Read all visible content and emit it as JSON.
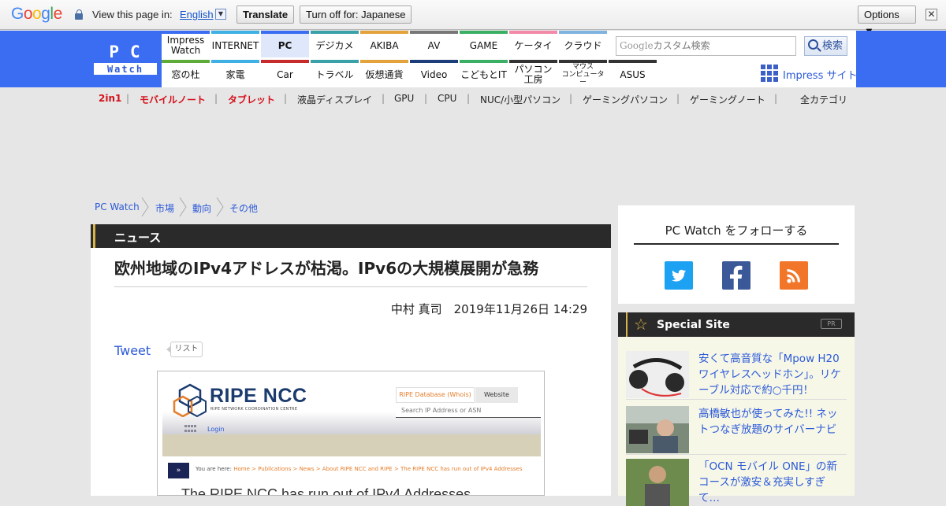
{
  "translate_bar": {
    "logo": "Google",
    "view_label": "View this page in:",
    "language": "English",
    "dropdown_glyph": "▼",
    "translate_button": "Translate",
    "turn_off_button": "Turn off for: Japanese",
    "options_button": "Options ▼",
    "close_glyph": "✕"
  },
  "site": {
    "logo_top": "PC",
    "logo_bottom": "Watch",
    "nav_top": [
      {
        "label": "Impress\nWatch",
        "color": "#3b6df2"
      },
      {
        "label": "INTERNET",
        "color": "#3fb0e4"
      },
      {
        "label": "PC",
        "color": "#3b6df2"
      },
      {
        "label": "デジカメ",
        "color": "#3aa1a8"
      },
      {
        "label": "AKIBA",
        "color": "#e3a23b"
      },
      {
        "label": "AV",
        "color": "#777777"
      },
      {
        "label": "GAME",
        "color": "#3bb064"
      },
      {
        "label": "ケータイ",
        "color": "#f28aa8"
      },
      {
        "label": "クラウド",
        "color": "#7fb3e0"
      }
    ],
    "nav_bottom": [
      {
        "label": "窓の杜",
        "color": "#5eab3a"
      },
      {
        "label": "家電",
        "color": "#3fb0e4"
      },
      {
        "label": "Car",
        "color": "#c62a2a"
      },
      {
        "label": "トラベル",
        "color": "#3aa1a8"
      },
      {
        "label": "仮想通貨",
        "color": "#e3a23b"
      },
      {
        "label": "Video",
        "color": "#1c3c7a"
      },
      {
        "label": "こどもとIT",
        "color": "#3bb064"
      },
      {
        "label": "パソコン\n工房",
        "color": "#333333"
      },
      {
        "label": "マウス\nコンピューター",
        "color": "#333333"
      },
      {
        "label": "ASUS",
        "color": "#333333"
      }
    ],
    "search_google": "Google",
    "search_placeholder": "カスタム検索",
    "search_button": "検索",
    "impress_link": "Impress サイト"
  },
  "categories": [
    "2in1",
    "モバイルノート",
    "タブレット",
    "液晶ディスプレイ",
    "GPU",
    "CPU",
    "NUC/小型パソコン",
    "ゲーミングパソコン",
    "ゲーミングノート",
    "全カテゴリ"
  ],
  "breadcrumb": [
    "PC Watch",
    "市場",
    "動向",
    "その他"
  ],
  "article": {
    "section": "ニュース",
    "headline": "欧州地域のIPv4アドレスが枯渇。IPv6の大規模展開が急務",
    "byline": "中村 真司　2019年11月26日 14:29",
    "tweet": "Tweet",
    "list": "リスト"
  },
  "embedded_screenshot": {
    "name": "RIPE NCC",
    "subtitle": "RIPE NETWORK COORDINATION CENTRE",
    "tab_whois": "RIPE Database (Whois)",
    "tab_website": "Website",
    "search_placeholder": "Search IP Address or ASN",
    "login": "Login",
    "crumb_prefix": "You are here:",
    "crumbs": "Home > Publications > News > About RIPE NCC and RIPE > The RIPE NCC has run out of IPv4 Addresses",
    "title": "The RIPE NCC has run out of IPv4 Addresses"
  },
  "sidebar": {
    "follow_title": "PC Watch をフォローする",
    "special_title": "Special Site",
    "pr": "PR",
    "items": [
      {
        "text": "安くて高音質な「Mpow H20 ワイヤレスヘッドホン」。リケーブル対応で約○千円！"
      },
      {
        "text": "高橋敏也が使ってみた!! ネットつなぎ放題のサイバーナビ"
      },
      {
        "text": "「OCN モバイル ONE」の新コースが激安＆充実しすぎて…"
      }
    ]
  }
}
